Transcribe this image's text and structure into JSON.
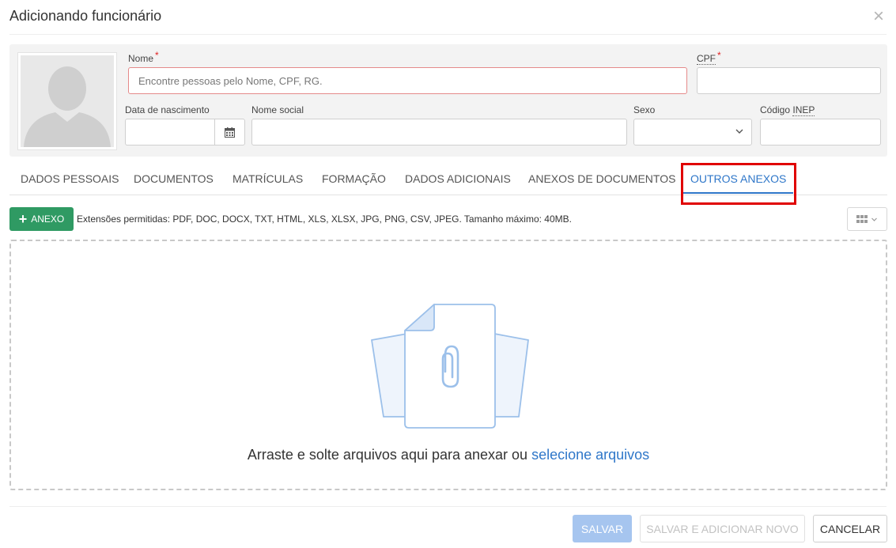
{
  "modal": {
    "title": "Adicionando funcionário",
    "close_glyph": "×"
  },
  "form": {
    "nome_label": "Nome",
    "nome_placeholder": "Encontre pessoas pelo Nome, CPF, RG.",
    "cpf_label": "CPF",
    "required_mark": "*",
    "data_nascimento_label": "Data de nascimento",
    "nome_social_label": "Nome social",
    "sexo_label": "Sexo",
    "codigo_label": "Código ",
    "inep_label": "INEP"
  },
  "tabs": [
    {
      "label": "DADOS PESSOAIS"
    },
    {
      "label": "DOCUMENTOS"
    },
    {
      "label": "MATRÍCULAS"
    },
    {
      "label": "FORMAÇÃO"
    },
    {
      "label": "DADOS ADICIONAIS"
    },
    {
      "label": "ANEXOS DE DOCUMENTOS"
    },
    {
      "label": "OUTROS ANEXOS",
      "active": true
    }
  ],
  "toolbar": {
    "add_label": "ANEXO",
    "add_icon": "plus-icon",
    "extensions_text": "Extensões permitidas: PDF, DOC, DOCX, TXT, HTML, XLS, XLSX, JPG, PNG, CSV, JPEG. Tamanho máximo: 40MB.",
    "view_icon": "grid-view-icon"
  },
  "dropzone": {
    "text": "Arraste e solte arquivos aqui para anexar ou ",
    "link": "selecione arquivos",
    "icon": "attachment-files-icon"
  },
  "footer": {
    "save_label": "SALVAR",
    "save_new_label": "SALVAR E ADICIONAR NOVO",
    "cancel_label": "CANCELAR"
  },
  "colors": {
    "primary": "#2f77c9",
    "success": "#2f9a63",
    "highlight": "#e00000",
    "required": "#e02424"
  }
}
